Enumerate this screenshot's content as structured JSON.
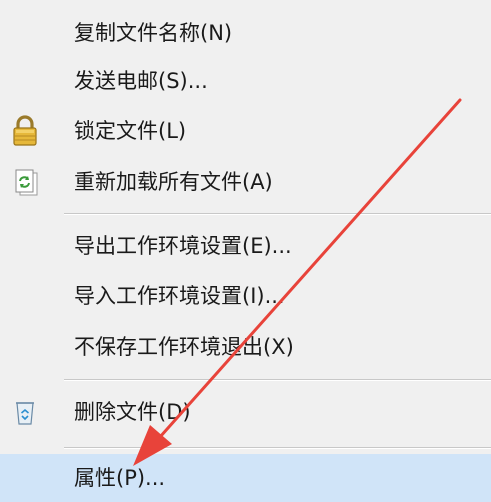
{
  "context_menu": {
    "items": [
      {
        "label": "复制文件名称(N)",
        "icon": null
      },
      {
        "label": "发送电邮(S)...",
        "icon": null
      },
      {
        "label": "锁定文件(L)",
        "icon": "lock-icon"
      },
      {
        "label": "重新加载所有文件(A)",
        "icon": "reload-document-icon"
      },
      {
        "label": "导出工作环境设置(E)...",
        "icon": null
      },
      {
        "label": "导入工作环境设置(I)...",
        "icon": null
      },
      {
        "label": "不保存工作环境退出(X)",
        "icon": null
      },
      {
        "label": "删除文件(D)",
        "icon": "recycle-bin-icon"
      },
      {
        "label": "属性(P)...",
        "icon": null,
        "highlighted": true
      }
    ]
  },
  "colors": {
    "menu_background": "#f0f0f0",
    "highlight_background": "#d0e4f8",
    "text": "#1a1a1a",
    "annotation_arrow": "#e8433a"
  }
}
